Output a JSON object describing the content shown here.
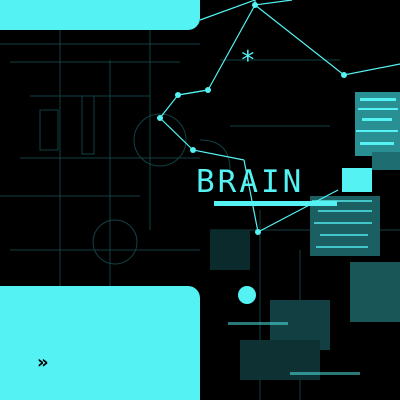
{
  "title": "BRAIN",
  "asterisk": "*",
  "chevrons": "»",
  "colors": {
    "accent": "#54f2f2",
    "background": "#000000"
  }
}
